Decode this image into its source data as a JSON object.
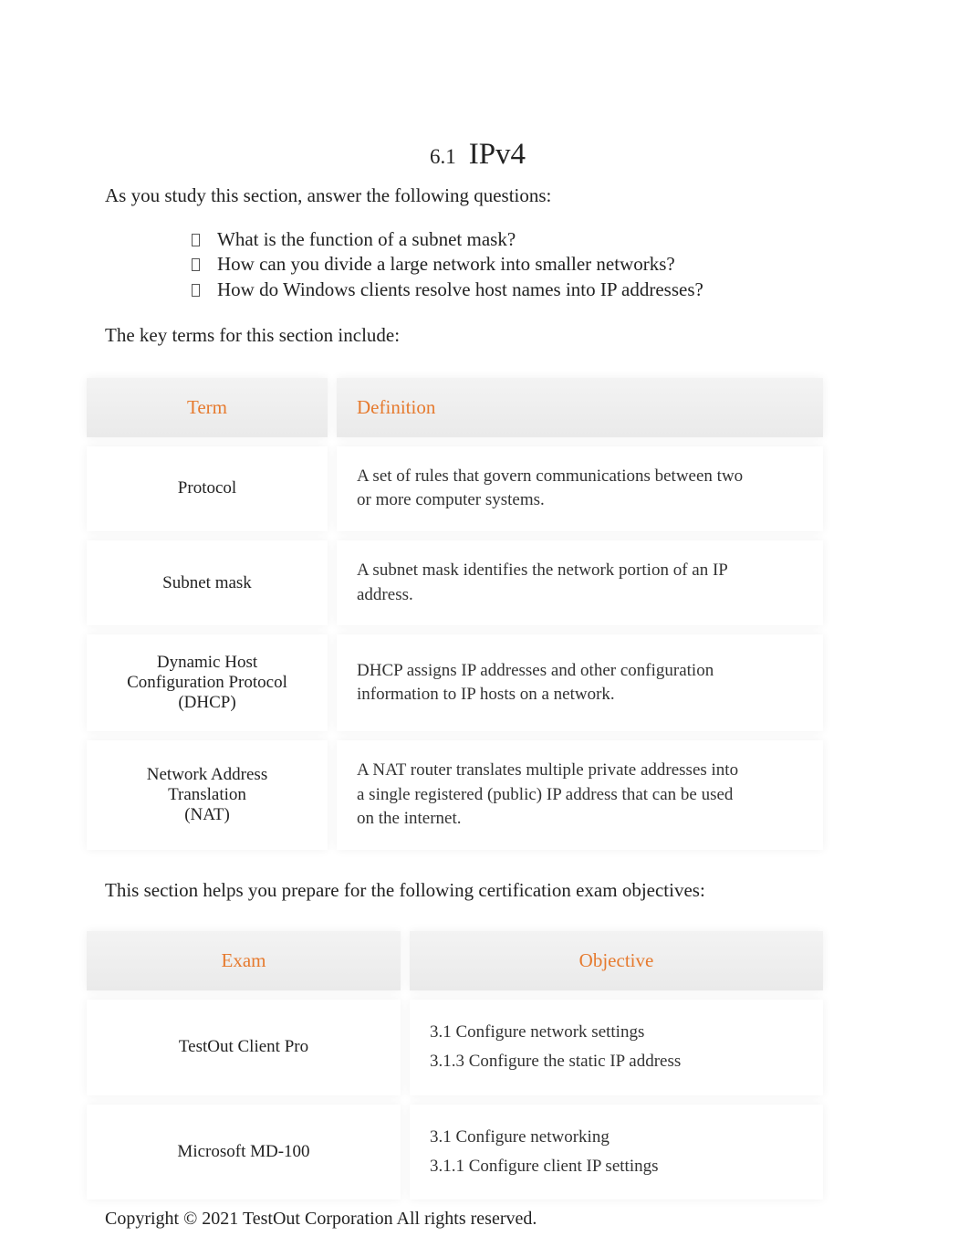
{
  "heading": {
    "section_number": "6.1",
    "title": "IPv4"
  },
  "intro_text": "As you study this section, answer the following questions:",
  "questions": [
    "What is the function of a subnet mask?",
    "How can you divide a large network into smaller networks?",
    "How do Windows clients resolve host names into IP addresses?"
  ],
  "keyterms_intro": "The key terms for this section include:",
  "terms_table": {
    "head": {
      "term": "Term",
      "definition": "Definition"
    },
    "rows": [
      {
        "term": "Protocol",
        "definition": "A set of rules that govern communications between two or more computer systems."
      },
      {
        "term": "Subnet mask",
        "definition": "A subnet mask identifies the network portion of an IP address."
      },
      {
        "term": "Dynamic Host Configuration Protocol\n(DHCP)",
        "definition": "DHCP assigns IP addresses and other configuration information to IP hosts on a network."
      },
      {
        "term": "Network Address Translation\n(NAT)",
        "definition": "A NAT router translates multiple private addresses into a single registered (public) IP address that can be used on the internet."
      }
    ]
  },
  "objectives_intro": "This section helps you prepare for the following certification exam objectives:",
  "objectives_table": {
    "head": {
      "exam": "Exam",
      "objective": "Objective"
    },
    "rows": [
      {
        "exam": "TestOut Client Pro",
        "objective": "3.1 Configure network settings\n3.1.3 Configure the static IP address"
      },
      {
        "exam": "Microsoft MD-100",
        "objective": "3.1 Configure networking\n3.1.1 Configure client IP settings"
      }
    ]
  },
  "copyright": "Copyright © 2021 TestOut Corporation All rights reserved."
}
